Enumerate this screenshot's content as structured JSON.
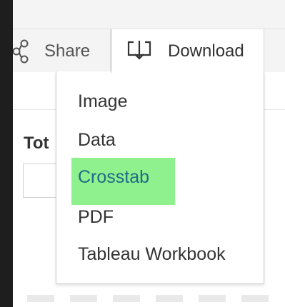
{
  "toolbar": {
    "share_label": "Share",
    "download_label": "Download",
    "share_icon": "share-icon",
    "download_icon": "download-icon"
  },
  "background": {
    "heading_partial": "Tot"
  },
  "download_menu": {
    "items": [
      {
        "label": "Image"
      },
      {
        "label": "Data"
      },
      {
        "label": "Crosstab",
        "highlighted": true
      },
      {
        "label": "PDF"
      },
      {
        "label": "Tableau Workbook"
      }
    ]
  },
  "colors": {
    "highlight": "#8ef18e",
    "highlight_text": "#1f6a86",
    "text": "#333333",
    "toolbar_bg": "#f4f4f4",
    "outer_bg": "#1e1e1e"
  }
}
